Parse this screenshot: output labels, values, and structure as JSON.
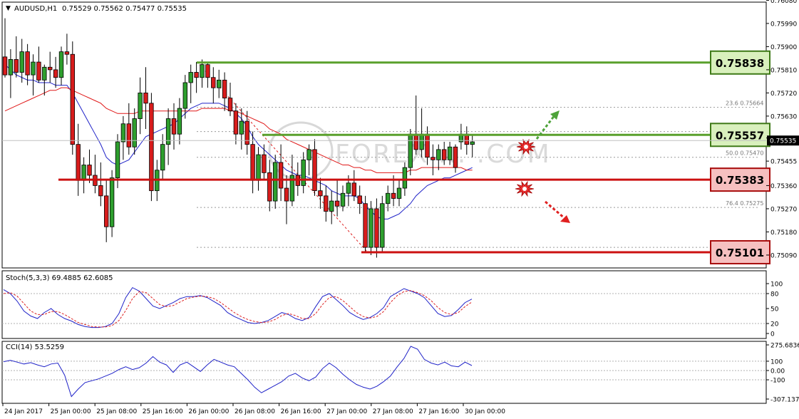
{
  "chart_data": [
    {
      "type": "candlestick",
      "header": {
        "symbol_timeframe": "AUDUSD,H1",
        "values": "0.75529 0.75562 0.75477 0.75535"
      },
      "y_range": [
        0.7504,
        0.7607
      ],
      "price_axis_ticks": [
        "0.76080",
        "0.75990",
        "0.75900",
        "0.75810",
        "0.75720",
        "0.75630",
        "0.75545",
        "0.75455",
        "0.75360",
        "0.75270",
        "0.75180",
        "0.75090"
      ],
      "current_price": "0.75535",
      "time_labels": [
        "24 Jan 2017",
        "25 Jan 00:00",
        "25 Jan 08:00",
        "25 Jan 16:00",
        "26 Jan 00:00",
        "26 Jan 08:00",
        "26 Jan 16:00",
        "27 Jan 00:00",
        "27 Jan 08:00",
        "27 Jan 16:00",
        "30 Jan 00:00"
      ],
      "candles": [
        [
          0.7586,
          0.7601,
          0.7578,
          0.7579
        ],
        [
          0.7579,
          0.7589,
          0.757,
          0.7585
        ],
        [
          0.7585,
          0.7594,
          0.7578,
          0.758
        ],
        [
          0.758,
          0.7593,
          0.7576,
          0.7588
        ],
        [
          0.7588,
          0.7591,
          0.7575,
          0.7579
        ],
        [
          0.7579,
          0.7587,
          0.7571,
          0.7584
        ],
        [
          0.7584,
          0.759,
          0.7576,
          0.7577
        ],
        [
          0.7577,
          0.7583,
          0.7571,
          0.7582
        ],
        [
          0.7582,
          0.7588,
          0.7576,
          0.7581
        ],
        [
          0.7581,
          0.7586,
          0.7574,
          0.7578
        ],
        [
          0.7578,
          0.759,
          0.7575,
          0.7588
        ],
        [
          0.7588,
          0.7595,
          0.7583,
          0.7587
        ],
        [
          0.7587,
          0.7592,
          0.7548,
          0.7552
        ],
        [
          0.7552,
          0.756,
          0.7532,
          0.7538
        ],
        [
          0.7538,
          0.7547,
          0.7533,
          0.7544
        ],
        [
          0.7544,
          0.755,
          0.7537,
          0.754
        ],
        [
          0.754,
          0.7548,
          0.7533,
          0.7536
        ],
        [
          0.7536,
          0.7545,
          0.7528,
          0.7532
        ],
        [
          0.7532,
          0.7538,
          0.7514,
          0.752
        ],
        [
          0.752,
          0.7542,
          0.7516,
          0.7539
        ],
        [
          0.7539,
          0.7556,
          0.7535,
          0.7553
        ],
        [
          0.7553,
          0.7563,
          0.7546,
          0.756
        ],
        [
          0.756,
          0.7568,
          0.7548,
          0.7551
        ],
        [
          0.7551,
          0.7566,
          0.7548,
          0.7562
        ],
        [
          0.7562,
          0.7578,
          0.7556,
          0.7572
        ],
        [
          0.7572,
          0.7582,
          0.7558,
          0.7568
        ],
        [
          0.7568,
          0.7572,
          0.753,
          0.7534
        ],
        [
          0.7534,
          0.7546,
          0.753,
          0.7542
        ],
        [
          0.7542,
          0.7556,
          0.7538,
          0.7552
        ],
        [
          0.7552,
          0.7566,
          0.7544,
          0.7562
        ],
        [
          0.7562,
          0.7568,
          0.755,
          0.7556
        ],
        [
          0.7556,
          0.757,
          0.7552,
          0.7566
        ],
        [
          0.7566,
          0.7579,
          0.7562,
          0.7576
        ],
        [
          0.7576,
          0.7583,
          0.7568,
          0.758
        ],
        [
          0.758,
          0.7584,
          0.7572,
          0.7578
        ],
        [
          0.7578,
          0.7585,
          0.7574,
          0.7583
        ],
        [
          0.7583,
          0.7584,
          0.7574,
          0.7578
        ],
        [
          0.7578,
          0.7582,
          0.7568,
          0.7574
        ],
        [
          0.7574,
          0.7581,
          0.757,
          0.7577
        ],
        [
          0.7577,
          0.758,
          0.7565,
          0.757
        ],
        [
          0.757,
          0.7576,
          0.7563,
          0.7565
        ],
        [
          0.7565,
          0.7568,
          0.7552,
          0.7556
        ],
        [
          0.7556,
          0.7566,
          0.755,
          0.7561
        ],
        [
          0.7561,
          0.7565,
          0.7548,
          0.7552
        ],
        [
          0.7552,
          0.7557,
          0.7533,
          0.7538
        ],
        [
          0.7538,
          0.7551,
          0.7534,
          0.7548
        ],
        [
          0.7548,
          0.7552,
          0.7538,
          0.7541
        ],
        [
          0.7541,
          0.7546,
          0.7526,
          0.753
        ],
        [
          0.753,
          0.7548,
          0.7527,
          0.7545
        ],
        [
          0.7545,
          0.7552,
          0.753,
          0.7535
        ],
        [
          0.7535,
          0.754,
          0.7521,
          0.753
        ],
        [
          0.753,
          0.7548,
          0.7528,
          0.754
        ],
        [
          0.754,
          0.7545,
          0.7532,
          0.7536
        ],
        [
          0.7536,
          0.7549,
          0.7533,
          0.7546
        ],
        [
          0.7546,
          0.7552,
          0.754,
          0.755
        ],
        [
          0.755,
          0.7554,
          0.7532,
          0.7534
        ],
        [
          0.7534,
          0.7539,
          0.7527,
          0.7532
        ],
        [
          0.7532,
          0.7536,
          0.7522,
          0.7526
        ],
        [
          0.7526,
          0.7534,
          0.7521,
          0.753
        ],
        [
          0.753,
          0.7538,
          0.7524,
          0.7528
        ],
        [
          0.7528,
          0.7536,
          0.7526,
          0.7533
        ],
        [
          0.7533,
          0.754,
          0.7528,
          0.7537
        ],
        [
          0.7537,
          0.7542,
          0.753,
          0.7532
        ],
        [
          0.7532,
          0.7536,
          0.7525,
          0.7529
        ],
        [
          0.7529,
          0.7532,
          0.751,
          0.7512
        ],
        [
          0.7512,
          0.753,
          0.7509,
          0.7527
        ],
        [
          0.7527,
          0.7531,
          0.7508,
          0.7512
        ],
        [
          0.7512,
          0.7532,
          0.751,
          0.7529
        ],
        [
          0.7529,
          0.7536,
          0.7526,
          0.7533
        ],
        [
          0.7533,
          0.754,
          0.7528,
          0.7531
        ],
        [
          0.7531,
          0.7538,
          0.7528,
          0.7535
        ],
        [
          0.7535,
          0.7545,
          0.7532,
          0.7543
        ],
        [
          0.7543,
          0.7558,
          0.754,
          0.7556
        ],
        [
          0.7556,
          0.7571,
          0.7548,
          0.755
        ],
        [
          0.755,
          0.7566,
          0.7547,
          0.7556
        ],
        [
          0.7556,
          0.7559,
          0.7544,
          0.7547
        ],
        [
          0.7547,
          0.7552,
          0.754,
          0.7546
        ],
        [
          0.7546,
          0.7552,
          0.7542,
          0.755
        ],
        [
          0.755,
          0.7553,
          0.7544,
          0.7546
        ],
        [
          0.7546,
          0.7553,
          0.7544,
          0.7551
        ],
        [
          0.7551,
          0.7552,
          0.7541,
          0.7543
        ],
        [
          0.7553,
          0.756,
          0.755,
          0.7556
        ],
        [
          0.7556,
          0.7559,
          0.7548,
          0.7552
        ],
        [
          0.7552,
          0.7556,
          0.7547,
          0.7553
        ]
      ],
      "moving_averages": [
        {
          "color": "#1f22c8",
          "values": [
            0.7583,
            0.7581,
            0.7579,
            0.7578,
            0.7577,
            0.7577,
            0.7576,
            0.7576,
            0.7576,
            0.7575,
            0.7575,
            0.7575,
            0.7572,
            0.7568,
            0.7564,
            0.756,
            0.7556,
            0.7552,
            0.7547,
            0.7545,
            0.7544,
            0.7545,
            0.7546,
            0.7549,
            0.7552,
            0.7555,
            0.7556,
            0.7557,
            0.7558,
            0.7559,
            0.756,
            0.7562,
            0.7564,
            0.7566,
            0.7567,
            0.7568,
            0.7568,
            0.7568,
            0.7568,
            0.7567,
            0.7566,
            0.7564,
            0.7562,
            0.7559,
            0.7555,
            0.7552,
            0.755,
            0.7548,
            0.7546,
            0.7544,
            0.7542,
            0.7541,
            0.754,
            0.754,
            0.7539,
            0.7538,
            0.7537,
            0.7536,
            0.7534,
            0.7533,
            0.7532,
            0.7532,
            0.7532,
            0.7531,
            0.7528,
            0.7526,
            0.7524,
            0.7523,
            0.7523,
            0.7524,
            0.7525,
            0.7527,
            0.7529,
            0.7532,
            0.7534,
            0.7536,
            0.7537,
            0.7538,
            0.7539,
            0.7539,
            0.754,
            0.7541,
            0.7542,
            0.7543
          ]
        },
        {
          "color": "#e01818",
          "values": [
            0.7565,
            0.7566,
            0.7567,
            0.7568,
            0.7569,
            0.757,
            0.7571,
            0.7572,
            0.7573,
            0.7573,
            0.7574,
            0.7574,
            0.7573,
            0.7572,
            0.7571,
            0.757,
            0.7569,
            0.7568,
            0.7566,
            0.7565,
            0.7564,
            0.7564,
            0.7564,
            0.7564,
            0.7565,
            0.7565,
            0.7565,
            0.7565,
            0.7565,
            0.7565,
            0.7565,
            0.7565,
            0.7565,
            0.7565,
            0.7565,
            0.7566,
            0.7566,
            0.7566,
            0.7566,
            0.7566,
            0.7565,
            0.7565,
            0.7564,
            0.7563,
            0.7562,
            0.7561,
            0.756,
            0.7558,
            0.7557,
            0.7556,
            0.7554,
            0.7553,
            0.7552,
            0.7551,
            0.755,
            0.7549,
            0.7548,
            0.7547,
            0.7546,
            0.7545,
            0.7544,
            0.7544,
            0.7543,
            0.7543,
            0.7542,
            0.7542,
            0.7541,
            0.7541,
            0.7541,
            0.7541,
            0.7541,
            0.7541,
            0.7542,
            0.7542,
            0.7543,
            0.7543,
            0.7543,
            0.7543,
            0.7543,
            0.7543,
            0.7543,
            0.7543,
            0.7542,
            0.7542
          ]
        }
      ],
      "levels": [
        {
          "value": 0.75838,
          "label": "0.75838",
          "color": "#5aa02c",
          "fill": "#d9f0bd",
          "border": "#3f7a18"
        },
        {
          "value": 0.75557,
          "label": "0.75557",
          "color": "#5aa02c",
          "fill": "#d9f0bd",
          "border": "#3f7a18"
        },
        {
          "value": 0.75383,
          "label": "0.75383",
          "color": "#cc1111",
          "fill": "#f6c0c0",
          "border": "#a80d0d"
        },
        {
          "value": 0.75101,
          "label": "0.75101",
          "color": "#cc1111",
          "fill": "#f6c0c0",
          "border": "#a80d0d"
        }
      ],
      "fibonacci_labels": [
        "23.6  0.75664",
        "50.0  0.75470",
        "76.4  0.75275"
      ],
      "watermark": "FOREX ... .COM"
    },
    {
      "type": "line",
      "header": "Stoch(5,3,3) 69.4885 62.6085",
      "y_range": [
        0,
        100
      ],
      "y_ticks": [
        "100",
        "80",
        "50",
        "20",
        "0"
      ],
      "series": [
        {
          "color": "#1f22c8",
          "values": [
            88,
            80,
            65,
            45,
            35,
            30,
            42,
            50,
            38,
            30,
            25,
            18,
            14,
            12,
            12,
            14,
            20,
            40,
            72,
            92,
            85,
            70,
            55,
            50,
            56,
            62,
            70,
            74,
            74,
            76,
            72,
            64,
            56,
            42,
            34,
            28,
            22,
            20,
            22,
            26,
            34,
            42,
            38,
            30,
            26,
            32,
            54,
            74,
            80,
            68,
            56,
            42,
            34,
            28,
            32,
            40,
            52,
            74,
            82,
            90,
            85,
            80,
            72,
            56,
            40,
            34,
            36,
            48,
            62,
            69
          ]
        },
        {
          "color": "#dd2222",
          "values": [
            80,
            82,
            75,
            60,
            45,
            38,
            38,
            44,
            44,
            38,
            30,
            22,
            18,
            14,
            13,
            13,
            16,
            26,
            46,
            70,
            84,
            82,
            70,
            58,
            54,
            56,
            63,
            70,
            73,
            75,
            74,
            70,
            62,
            52,
            42,
            34,
            28,
            24,
            22,
            23,
            28,
            36,
            40,
            36,
            30,
            30,
            40,
            58,
            72,
            74,
            66,
            54,
            42,
            34,
            31,
            34,
            44,
            62,
            76,
            84,
            86,
            82,
            76,
            66,
            52,
            42,
            38,
            42,
            54,
            63
          ]
        }
      ]
    },
    {
      "type": "line",
      "header": "CCI(14) 53.5259",
      "y_range": [
        -307.1376,
        275.6836
      ],
      "y_ticks": [
        "275.6836",
        "100",
        "0.00",
        "-100",
        "-307.1376"
      ],
      "series": [
        {
          "color": "#1f22c8",
          "values": [
            95,
            110,
            90,
            70,
            85,
            60,
            40,
            70,
            80,
            -50,
            -280,
            -200,
            -130,
            -110,
            -90,
            -60,
            -30,
            10,
            40,
            10,
            30,
            80,
            150,
            90,
            60,
            -20,
            60,
            90,
            40,
            -10,
            60,
            120,
            90,
            60,
            40,
            -30,
            -100,
            -180,
            -240,
            -200,
            -160,
            -120,
            -60,
            -30,
            -80,
            -110,
            -70,
            20,
            80,
            30,
            -40,
            -100,
            -150,
            -180,
            -200,
            -170,
            -120,
            -60,
            40,
            130,
            260,
            230,
            120,
            80,
            60,
            90,
            50,
            40,
            90,
            53
          ]
        }
      ]
    }
  ]
}
